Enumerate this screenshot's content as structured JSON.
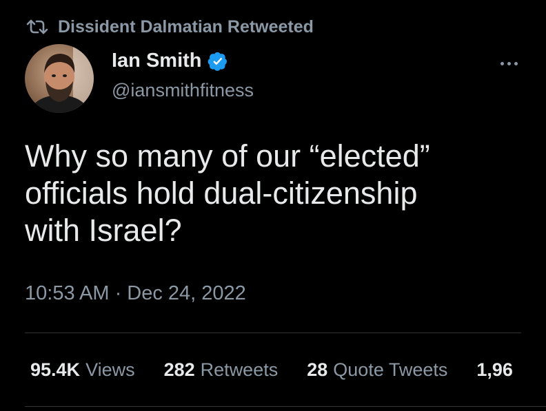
{
  "retweet_context": {
    "icon": "retweet-icon",
    "label": "Dissident Dalmatian Retweeted"
  },
  "author": {
    "display_name": "Ian Smith",
    "verified_icon": "verified-badge-icon",
    "verified_color": "#1d9bf0",
    "handle": "@iansmithfitness"
  },
  "more_menu_icon": "more-icon",
  "tweet": {
    "text_lines": [
      "Why so many of our “elected”",
      "officials hold dual-citizenship",
      "with Israel?"
    ],
    "timestamp": "10:53 AM · Dec 24, 2022"
  },
  "stats": [
    {
      "value": "95.4K",
      "label": "Views"
    },
    {
      "value": "282",
      "label": "Retweets"
    },
    {
      "value": "28",
      "label": "Quote Tweets"
    },
    {
      "value": "1,96",
      "label": ""
    }
  ],
  "colors": {
    "background": "#000000",
    "primary_text": "#e7e9ea",
    "secondary_text": "#8b98a5",
    "divider": "#2f3336"
  }
}
